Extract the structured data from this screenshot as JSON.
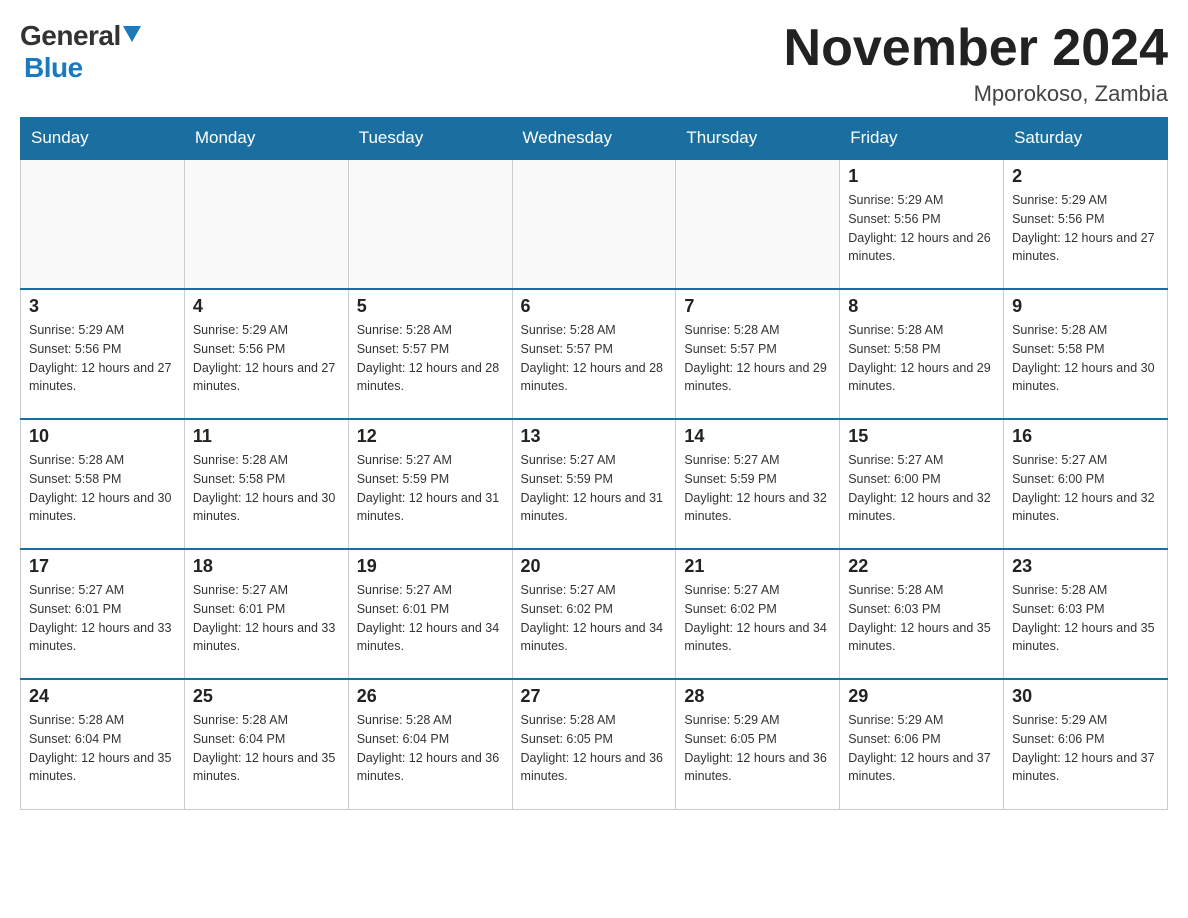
{
  "logo": {
    "general": "General",
    "blue": "Blue"
  },
  "title": "November 2024",
  "location": "Mporokoso, Zambia",
  "days_of_week": [
    "Sunday",
    "Monday",
    "Tuesday",
    "Wednesday",
    "Thursday",
    "Friday",
    "Saturday"
  ],
  "weeks": [
    [
      {
        "day": "",
        "info": ""
      },
      {
        "day": "",
        "info": ""
      },
      {
        "day": "",
        "info": ""
      },
      {
        "day": "",
        "info": ""
      },
      {
        "day": "",
        "info": ""
      },
      {
        "day": "1",
        "info": "Sunrise: 5:29 AM\nSunset: 5:56 PM\nDaylight: 12 hours and 26 minutes."
      },
      {
        "day": "2",
        "info": "Sunrise: 5:29 AM\nSunset: 5:56 PM\nDaylight: 12 hours and 27 minutes."
      }
    ],
    [
      {
        "day": "3",
        "info": "Sunrise: 5:29 AM\nSunset: 5:56 PM\nDaylight: 12 hours and 27 minutes."
      },
      {
        "day": "4",
        "info": "Sunrise: 5:29 AM\nSunset: 5:56 PM\nDaylight: 12 hours and 27 minutes."
      },
      {
        "day": "5",
        "info": "Sunrise: 5:28 AM\nSunset: 5:57 PM\nDaylight: 12 hours and 28 minutes."
      },
      {
        "day": "6",
        "info": "Sunrise: 5:28 AM\nSunset: 5:57 PM\nDaylight: 12 hours and 28 minutes."
      },
      {
        "day": "7",
        "info": "Sunrise: 5:28 AM\nSunset: 5:57 PM\nDaylight: 12 hours and 29 minutes."
      },
      {
        "day": "8",
        "info": "Sunrise: 5:28 AM\nSunset: 5:58 PM\nDaylight: 12 hours and 29 minutes."
      },
      {
        "day": "9",
        "info": "Sunrise: 5:28 AM\nSunset: 5:58 PM\nDaylight: 12 hours and 30 minutes."
      }
    ],
    [
      {
        "day": "10",
        "info": "Sunrise: 5:28 AM\nSunset: 5:58 PM\nDaylight: 12 hours and 30 minutes."
      },
      {
        "day": "11",
        "info": "Sunrise: 5:28 AM\nSunset: 5:58 PM\nDaylight: 12 hours and 30 minutes."
      },
      {
        "day": "12",
        "info": "Sunrise: 5:27 AM\nSunset: 5:59 PM\nDaylight: 12 hours and 31 minutes."
      },
      {
        "day": "13",
        "info": "Sunrise: 5:27 AM\nSunset: 5:59 PM\nDaylight: 12 hours and 31 minutes."
      },
      {
        "day": "14",
        "info": "Sunrise: 5:27 AM\nSunset: 5:59 PM\nDaylight: 12 hours and 32 minutes."
      },
      {
        "day": "15",
        "info": "Sunrise: 5:27 AM\nSunset: 6:00 PM\nDaylight: 12 hours and 32 minutes."
      },
      {
        "day": "16",
        "info": "Sunrise: 5:27 AM\nSunset: 6:00 PM\nDaylight: 12 hours and 32 minutes."
      }
    ],
    [
      {
        "day": "17",
        "info": "Sunrise: 5:27 AM\nSunset: 6:01 PM\nDaylight: 12 hours and 33 minutes."
      },
      {
        "day": "18",
        "info": "Sunrise: 5:27 AM\nSunset: 6:01 PM\nDaylight: 12 hours and 33 minutes."
      },
      {
        "day": "19",
        "info": "Sunrise: 5:27 AM\nSunset: 6:01 PM\nDaylight: 12 hours and 34 minutes."
      },
      {
        "day": "20",
        "info": "Sunrise: 5:27 AM\nSunset: 6:02 PM\nDaylight: 12 hours and 34 minutes."
      },
      {
        "day": "21",
        "info": "Sunrise: 5:27 AM\nSunset: 6:02 PM\nDaylight: 12 hours and 34 minutes."
      },
      {
        "day": "22",
        "info": "Sunrise: 5:28 AM\nSunset: 6:03 PM\nDaylight: 12 hours and 35 minutes."
      },
      {
        "day": "23",
        "info": "Sunrise: 5:28 AM\nSunset: 6:03 PM\nDaylight: 12 hours and 35 minutes."
      }
    ],
    [
      {
        "day": "24",
        "info": "Sunrise: 5:28 AM\nSunset: 6:04 PM\nDaylight: 12 hours and 35 minutes."
      },
      {
        "day": "25",
        "info": "Sunrise: 5:28 AM\nSunset: 6:04 PM\nDaylight: 12 hours and 35 minutes."
      },
      {
        "day": "26",
        "info": "Sunrise: 5:28 AM\nSunset: 6:04 PM\nDaylight: 12 hours and 36 minutes."
      },
      {
        "day": "27",
        "info": "Sunrise: 5:28 AM\nSunset: 6:05 PM\nDaylight: 12 hours and 36 minutes."
      },
      {
        "day": "28",
        "info": "Sunrise: 5:29 AM\nSunset: 6:05 PM\nDaylight: 12 hours and 36 minutes."
      },
      {
        "day": "29",
        "info": "Sunrise: 5:29 AM\nSunset: 6:06 PM\nDaylight: 12 hours and 37 minutes."
      },
      {
        "day": "30",
        "info": "Sunrise: 5:29 AM\nSunset: 6:06 PM\nDaylight: 12 hours and 37 minutes."
      }
    ]
  ]
}
